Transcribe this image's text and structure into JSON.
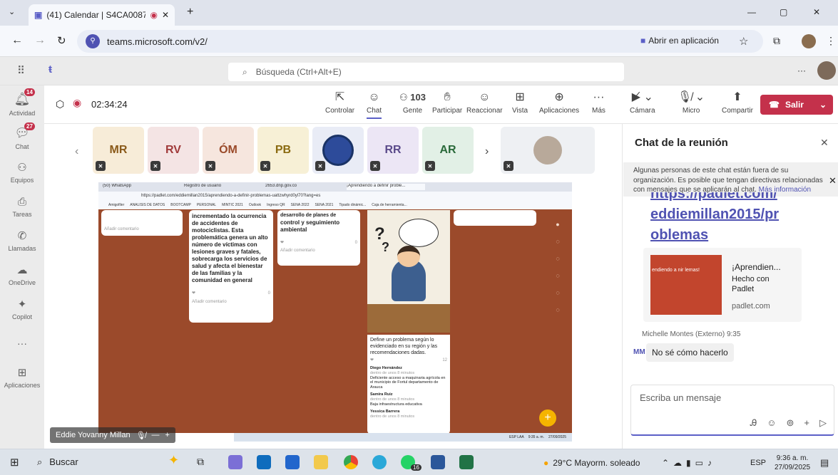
{
  "browser": {
    "tab_title": "(41) Calendar | S4CA008726",
    "tab_new": "+",
    "url": "teams.microsoft.com/v2/",
    "open_app": "Abrir en aplicación",
    "win_min": "—",
    "win_max": "▢",
    "win_close": "✕"
  },
  "teams": {
    "search_placeholder": "Búsqueda (Ctrl+Alt+E)",
    "more": "···"
  },
  "rail": [
    {
      "label": "Actividad",
      "icon": "bell-icon",
      "badge": "14"
    },
    {
      "label": "Chat",
      "icon": "chat-icon",
      "badge": "27"
    },
    {
      "label": "Equipos",
      "icon": "teams-icon",
      "badge": ""
    },
    {
      "label": "Tareas",
      "icon": "tasks-icon",
      "badge": ""
    },
    {
      "label": "Llamadas",
      "icon": "phone-icon",
      "badge": ""
    },
    {
      "label": "OneDrive",
      "icon": "cloud-icon",
      "badge": ""
    },
    {
      "label": "Copilot",
      "icon": "copilot-icon",
      "badge": ""
    },
    {
      "label": "···",
      "icon": "more-icon",
      "badge": ""
    },
    {
      "label": "Aplicaciones",
      "icon": "apps-icon",
      "badge": ""
    }
  ],
  "meeting": {
    "timer": "02:34:24",
    "people_count": "103",
    "tools": {
      "controlar": "Controlar",
      "chat": "Chat",
      "gente": "Gente",
      "participar": "Participar",
      "reaccionar": "Reaccionar",
      "vista": "Vista",
      "aplicaciones": "Aplicaciones",
      "mas": "Más",
      "camara": "Cámara",
      "micro": "Micro",
      "compartir": "Compartir",
      "salir": "Salir"
    },
    "tiles": [
      "MR",
      "RV",
      "ÓM",
      "PB",
      "RR",
      "AR"
    ],
    "presenter": "Eddie Yovanny Millan"
  },
  "shared": {
    "tabs": [
      "(50) WhatsApp",
      "Registro de usuario",
      "2653.dnp.gov.co",
      "¡Aprendiendo a definir proble..."
    ],
    "url": "https://padlet.com/eddiemillan2015/aprendiendo-a-definir-problemas-uattzwhyrd0yl70?lang=es",
    "bookmarks": [
      "Amigofiler",
      "ANALISIS DE DATOS",
      "BOOTCAMP",
      "PERSONAL",
      "MINTIC 2021",
      "Outlook",
      "Ingreso QR",
      "SENA 2022",
      "SENA 2021",
      "Tipado dinámic...",
      "Caja de herramienta..."
    ],
    "card1": "incrementado la ocurrencia de accidentes de motociclistas. Esta problemática genera un alto número de víctimas con lesiones graves y fatales, sobrecarga los servicios de salud y afecta el bienestar de las familias y la comunidad en general",
    "card1_add": "Añadir comentario",
    "card1_count": "0",
    "card2": "control y seguimiento ambiental",
    "card2_top": "desarrollo de planes de",
    "card2_add": "Añadir comentario",
    "card2_count": "0",
    "card3": "Define un problema según lo evidenciado en su región y las recomendaciones dadas.",
    "card3_count": "12",
    "comments": [
      {
        "name": "Diego Hernández",
        "time": "dentro de unos 8 minutos",
        "text": "Deficiente acceso a maquinaria agrícola en el municipio de Fortul departamento de Arauca"
      },
      {
        "name": "Samira Ruiz",
        "time": "dentro de unos 8 minutos",
        "text": "Baja infraestructura educativa"
      },
      {
        "name": "Yessica Barrera",
        "time": "dentro de unos 8 minutos",
        "text": ""
      }
    ],
    "left_add": "Añadir comentario",
    "tray_lang": "ESP LAA",
    "tray_time": "9:35 a. m.",
    "tray_date": "27/09/2025"
  },
  "chat": {
    "title": "Chat de la reunión",
    "notice": "Algunas personas de este chat están fuera de su organización. Es posible que tengan directivas relacionadas con mensajes que se aplicarán al chat.",
    "notice_link": "Más información",
    "link_line1": "https://padlet.com/",
    "link_line2": "eddiemillan2015/pr",
    "link_line3": "oblemas",
    "preview_title": "¡Aprendien...",
    "preview_made": "Hecho con",
    "preview_app": "Padlet",
    "preview_domain": "padlet.com",
    "preview_thumb": "endiendo a nir lemas!",
    "msg_author": "Michelle Montes (Externo)",
    "msg_time": "9:35",
    "msg_initials": "MM",
    "msg_text": "No sé cómo hacerlo",
    "compose_placeholder": "Escriba un mensaje"
  },
  "taskbar": {
    "search": "Buscar",
    "weather": "29°C Mayorm. soleado",
    "lang": "ESP",
    "time": "9:36 a. m.",
    "date": "27/09/2025",
    "whatsapp_badge": "16"
  },
  "colors": {
    "teams_purple": "#5b5fc7",
    "leave_red": "#c4314b",
    "brick": "#a4512f",
    "link_blue": "#4f52b2"
  }
}
